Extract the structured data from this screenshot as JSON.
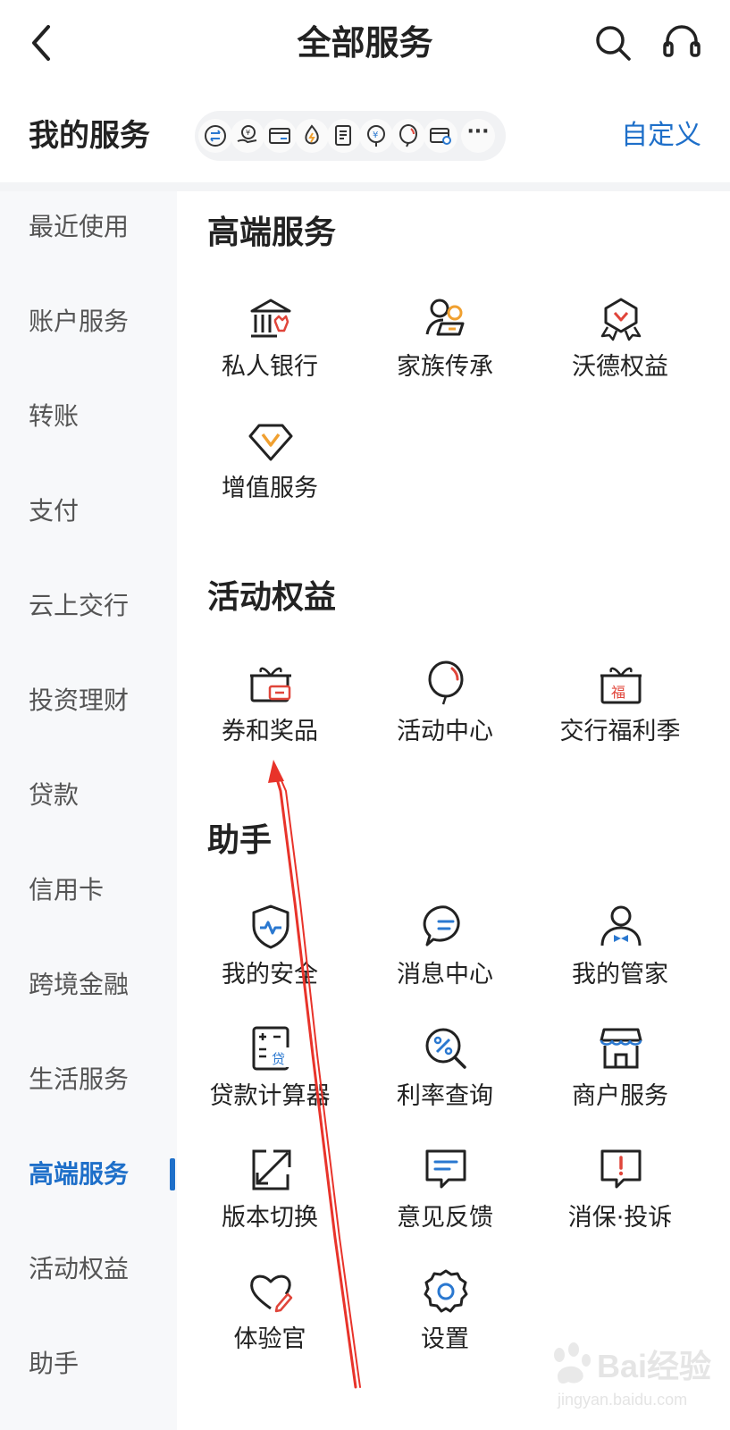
{
  "nav": {
    "title": "全部服务",
    "back_icon": "chevron-left-icon",
    "search_icon": "search-icon",
    "service_icon": "headset-icon"
  },
  "my_services": {
    "title": "我的服务",
    "customize_label": "自定义",
    "shortcut_icons": [
      "exchange-icon",
      "wealth-hand-icon",
      "card-icon",
      "flame-icon",
      "document-icon",
      "yuan-tree-icon",
      "balloon-icon",
      "card-link-icon"
    ],
    "more_label": "···"
  },
  "sidebar": {
    "items": [
      {
        "label": "最近使用"
      },
      {
        "label": "账户服务"
      },
      {
        "label": "转账"
      },
      {
        "label": "支付"
      },
      {
        "label": "云上交行"
      },
      {
        "label": "投资理财"
      },
      {
        "label": "贷款"
      },
      {
        "label": "信用卡"
      },
      {
        "label": "跨境金融"
      },
      {
        "label": "生活服务"
      },
      {
        "label": "高端服务",
        "active": true
      },
      {
        "label": "活动权益"
      },
      {
        "label": "助手"
      }
    ]
  },
  "sections": [
    {
      "title": "高端服务",
      "items": [
        {
          "label": "私人银行",
          "icon": "private-bank-icon"
        },
        {
          "label": "家族传承",
          "icon": "family-icon"
        },
        {
          "label": "沃德权益",
          "icon": "badge-icon"
        },
        {
          "label": "增值服务",
          "icon": "diamond-icon"
        }
      ]
    },
    {
      "title": "活动权益",
      "items": [
        {
          "label": "券和奖品",
          "icon": "gift-coupon-icon"
        },
        {
          "label": "活动中心",
          "icon": "balloon-icon"
        },
        {
          "label": "交行福利季",
          "icon": "gift-box-fu-icon"
        }
      ]
    },
    {
      "title": "助手",
      "items": [
        {
          "label": "我的安全",
          "icon": "shield-icon"
        },
        {
          "label": "消息中心",
          "icon": "chat-bubble-icon"
        },
        {
          "label": "我的管家",
          "icon": "butler-icon"
        },
        {
          "label": "贷款计算器",
          "icon": "calculator-icon"
        },
        {
          "label": "利率查询",
          "icon": "percent-search-icon"
        },
        {
          "label": "商户服务",
          "icon": "store-icon"
        },
        {
          "label": "版本切换",
          "icon": "expand-icon"
        },
        {
          "label": "意见反馈",
          "icon": "feedback-icon"
        },
        {
          "label": "消保·投诉",
          "icon": "complaint-icon"
        },
        {
          "label": "体验官",
          "icon": "heart-pen-icon"
        },
        {
          "label": "设置",
          "icon": "gear-icon"
        }
      ]
    }
  ],
  "watermark": {
    "brand": "Bai经验",
    "url": "jingyan.baidu.com"
  },
  "colors": {
    "accent": "#1e6fc9",
    "icon_orange": "#f0a030",
    "icon_red": "#e0453a",
    "icon_blue": "#2a78d0",
    "annotation_red": "#e8332a"
  }
}
